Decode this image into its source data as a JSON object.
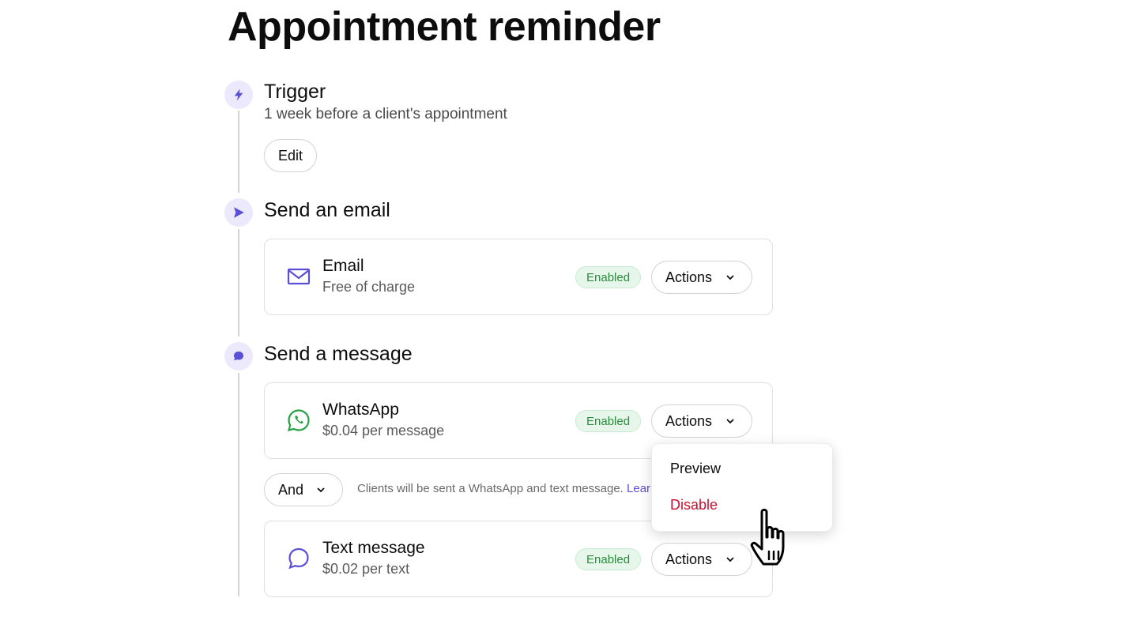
{
  "page": {
    "title": "Appointment reminder"
  },
  "trigger": {
    "title": "Trigger",
    "description": "1 week before a client's appointment",
    "edit_label": "Edit",
    "icon": "lightning-icon"
  },
  "email_step": {
    "title": "Send an email",
    "icon": "send-icon",
    "card": {
      "title": "Email",
      "subtitle": "Free of charge",
      "status": "Enabled",
      "actions_label": "Actions",
      "icon": "envelope-icon"
    }
  },
  "message_step": {
    "title": "Send a message",
    "icon": "chat-bubble-icon",
    "whatsapp": {
      "title": "WhatsApp",
      "subtitle": "$0.04 per message",
      "status": "Enabled",
      "actions_label": "Actions",
      "icon": "whatsapp-icon"
    },
    "combiner": {
      "label": "And",
      "info": "Clients will be sent a WhatsApp and text message.",
      "link": "Learn"
    },
    "sms": {
      "title": "Text message",
      "subtitle": "$0.02 per text",
      "status": "Enabled",
      "actions_label": "Actions",
      "icon": "speech-bubble-icon"
    }
  },
  "actions_menu": {
    "items": [
      "Preview",
      "Disable"
    ]
  },
  "colors": {
    "accent": "#5b4fd6",
    "enabled_green": "#2a8a3c",
    "danger": "#c8102e",
    "whatsapp_green": "#25a244"
  }
}
